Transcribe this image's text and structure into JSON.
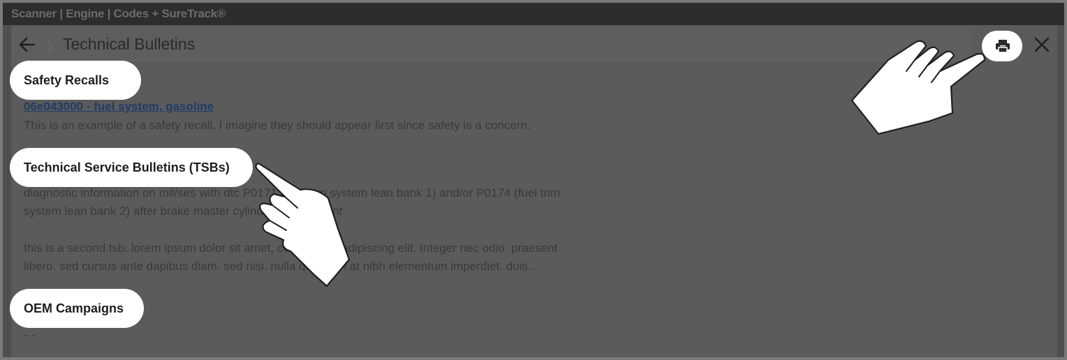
{
  "window": {
    "title": "Scanner | Engine | Codes + SureTrack®"
  },
  "navbar": {
    "back_icon": "arrow-left-icon",
    "page_title": "Technical Bulletins",
    "print_icon": "printer-icon",
    "close_icon": "close-icon"
  },
  "sections": {
    "safety_recalls": {
      "heading": "Safety Recalls",
      "item_link": "06e043000 - fuel system, gasoline",
      "item_desc": "This is an example of a safety recall. I imagine they should appear first since safety is a concern."
    },
    "tsbs": {
      "heading": "Technical Service Bulletins (TSBs)",
      "item1_line1": "diagnostic information on mil/ses with dtc P0171 (fuel trim system lean bank 1) and/or P0174 (fuel trim",
      "item1_line2": "system lean bank 2) after brake master cylinder replacement",
      "item2_line1": "this is a second tsb. lorem ipsum dolor sit amet, consectetur adipiscing elit. Integer nec odio. praesent",
      "item2_line2": "libero. sed cursus ante dapibus diam. sed nisi. nulla quis sem at nibh elementum imperdiet. duis..."
    },
    "oem_campaigns": {
      "heading": "OEM Campaigns",
      "empty_text": "- -"
    }
  },
  "overlays": {
    "hand_icon": "pointing-hand-icon"
  }
}
